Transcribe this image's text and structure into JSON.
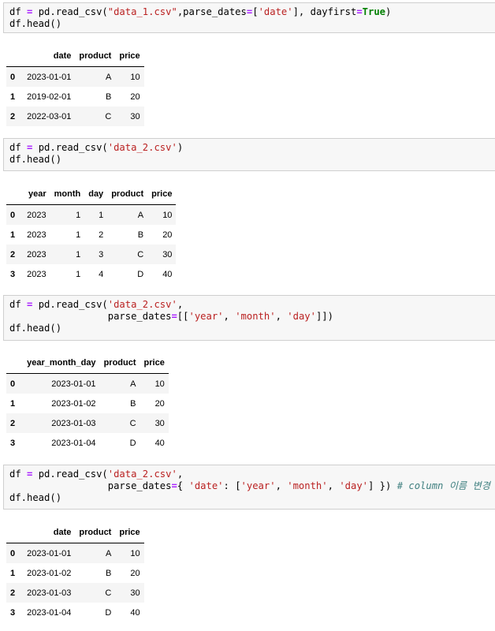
{
  "cells": [
    {
      "lines": [
        [
          {
            "t": "df "
          },
          {
            "t": "=",
            "c": "op"
          },
          {
            "t": " pd.read_csv("
          },
          {
            "t": "\"data_1.csv\"",
            "c": "str"
          },
          {
            "t": ",parse_dates"
          },
          {
            "t": "=",
            "c": "op"
          },
          {
            "t": "["
          },
          {
            "t": "'date'",
            "c": "str"
          },
          {
            "t": "], dayfirst"
          },
          {
            "t": "=",
            "c": "op"
          },
          {
            "t": "True",
            "c": "kw"
          },
          {
            "t": ")"
          }
        ],
        [
          {
            "t": "df.head()"
          }
        ]
      ],
      "table": {
        "columns": [
          "",
          "date",
          "product",
          "price"
        ],
        "rows": [
          [
            "0",
            "2023-01-01",
            "A",
            "10"
          ],
          [
            "1",
            "2019-02-01",
            "B",
            "20"
          ],
          [
            "2",
            "2022-03-01",
            "C",
            "30"
          ]
        ]
      }
    },
    {
      "lines": [
        [
          {
            "t": "df "
          },
          {
            "t": "=",
            "c": "op"
          },
          {
            "t": " pd.read_csv("
          },
          {
            "t": "'data_2.csv'",
            "c": "str"
          },
          {
            "t": ")"
          }
        ],
        [
          {
            "t": "df.head()"
          }
        ]
      ],
      "table": {
        "columns": [
          "",
          "year",
          "month",
          "day",
          "product",
          "price"
        ],
        "rows": [
          [
            "0",
            "2023",
            "1",
            "1",
            "A",
            "10"
          ],
          [
            "1",
            "2023",
            "1",
            "2",
            "B",
            "20"
          ],
          [
            "2",
            "2023",
            "1",
            "3",
            "C",
            "30"
          ],
          [
            "3",
            "2023",
            "1",
            "4",
            "D",
            "40"
          ]
        ]
      }
    },
    {
      "lines": [
        [
          {
            "t": "df "
          },
          {
            "t": "=",
            "c": "op"
          },
          {
            "t": " pd.read_csv("
          },
          {
            "t": "'data_2.csv'",
            "c": "str"
          },
          {
            "t": ","
          }
        ],
        [
          {
            "t": "                 parse_dates"
          },
          {
            "t": "=",
            "c": "op"
          },
          {
            "t": "[["
          },
          {
            "t": "'year'",
            "c": "str"
          },
          {
            "t": ", "
          },
          {
            "t": "'month'",
            "c": "str"
          },
          {
            "t": ", "
          },
          {
            "t": "'day'",
            "c": "str"
          },
          {
            "t": "]])"
          }
        ],
        [
          {
            "t": "df.head()"
          }
        ]
      ],
      "table": {
        "columns": [
          "",
          "year_month_day",
          "product",
          "price"
        ],
        "rows": [
          [
            "0",
            "2023-01-01",
            "A",
            "10"
          ],
          [
            "1",
            "2023-01-02",
            "B",
            "20"
          ],
          [
            "2",
            "2023-01-03",
            "C",
            "30"
          ],
          [
            "3",
            "2023-01-04",
            "D",
            "40"
          ]
        ]
      }
    },
    {
      "lines": [
        [
          {
            "t": "df "
          },
          {
            "t": "=",
            "c": "op"
          },
          {
            "t": " pd.read_csv("
          },
          {
            "t": "'data_2.csv'",
            "c": "str"
          },
          {
            "t": ","
          }
        ],
        [
          {
            "t": "                 parse_dates"
          },
          {
            "t": "=",
            "c": "op"
          },
          {
            "t": "{ "
          },
          {
            "t": "'date'",
            "c": "str"
          },
          {
            "t": ": ["
          },
          {
            "t": "'year'",
            "c": "str"
          },
          {
            "t": ", "
          },
          {
            "t": "'month'",
            "c": "str"
          },
          {
            "t": ", "
          },
          {
            "t": "'day'",
            "c": "str"
          },
          {
            "t": "] }) "
          },
          {
            "t": "# column 이름 변경",
            "c": "cm"
          }
        ],
        [
          {
            "t": "df.head()"
          }
        ]
      ],
      "table": {
        "columns": [
          "",
          "date",
          "product",
          "price"
        ],
        "rows": [
          [
            "0",
            "2023-01-01",
            "A",
            "10"
          ],
          [
            "1",
            "2023-01-02",
            "B",
            "20"
          ],
          [
            "2",
            "2023-01-03",
            "C",
            "30"
          ],
          [
            "3",
            "2023-01-04",
            "D",
            "40"
          ]
        ]
      }
    }
  ]
}
